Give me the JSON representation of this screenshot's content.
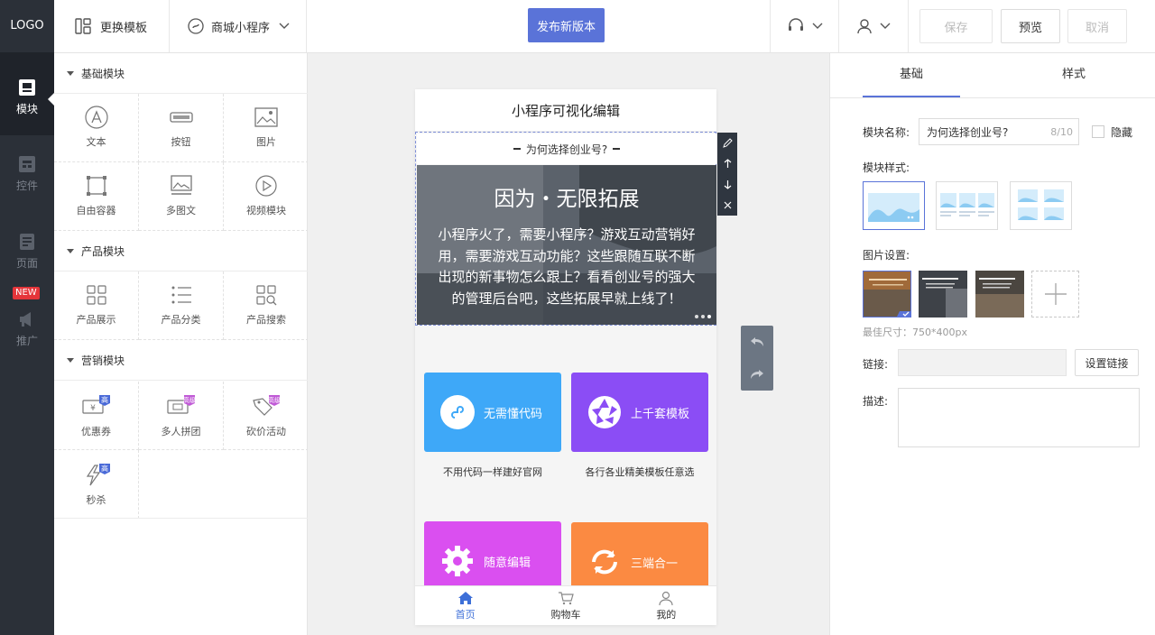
{
  "app": {
    "logo": "LOGO"
  },
  "rail": {
    "items": [
      {
        "label": "模块",
        "active": true
      },
      {
        "label": "控件"
      },
      {
        "label": "页面"
      },
      {
        "label": "推广"
      }
    ],
    "new_badge": "NEW"
  },
  "topbar": {
    "change_template": "更换模板",
    "mall_app": "商城小程序",
    "publish": "发布新版本",
    "save": "保存",
    "preview": "预览",
    "cancel": "取消"
  },
  "left": {
    "sections": [
      {
        "title": "基础模块",
        "items": [
          "文本",
          "按钮",
          "图片",
          "自由容器",
          "多图文",
          "视频模块"
        ]
      },
      {
        "title": "产品模块",
        "items": [
          "产品展示",
          "产品分类",
          "产品搜索"
        ]
      },
      {
        "title": "营销模块",
        "items": [
          "优惠券",
          "多人拼团",
          "砍价活动",
          "秒杀"
        ],
        "badges": [
          "高",
          "高级",
          "高级",
          "高"
        ]
      }
    ]
  },
  "phone": {
    "title": "小程序可视化编辑",
    "module_title": "为何选择创业号?",
    "banner_heading": "因为・无限拓展",
    "banner_text": "小程序火了，需要小程序？游戏互动营销好用，需要游戏互动功能？这些跟随互联不断出现的新事物怎么跟上？看看创业号的强大的管理后台吧，这些拓展早就上线了！",
    "features": [
      {
        "label": "无需懂代码",
        "caption": "不用代码一样建好官网",
        "color": "#3ea8f8"
      },
      {
        "label": "上千套模板",
        "caption": "各行各业精美模板任意选",
        "color": "#8b4df5"
      },
      {
        "label": "随意编辑",
        "caption": "",
        "color": "#da4ff0"
      },
      {
        "label": "三端合一",
        "caption": "",
        "color": "#fb8a42"
      }
    ],
    "tabs": [
      "首页",
      "购物车",
      "我的"
    ]
  },
  "right": {
    "tabs": [
      "基础",
      "样式"
    ],
    "name_label": "模块名称:",
    "name_value": "为何选择创业号?",
    "name_count": "8/10",
    "hide_label": "隐藏",
    "style_label": "模块样式:",
    "image_label": "图片设置:",
    "size_hint": "最佳尺寸：750*400px",
    "link_label": "链接:",
    "link_button": "设置链接",
    "desc_label": "描述:"
  },
  "colors": {
    "accent": "#5a73d8",
    "rail": "#2b3038"
  }
}
